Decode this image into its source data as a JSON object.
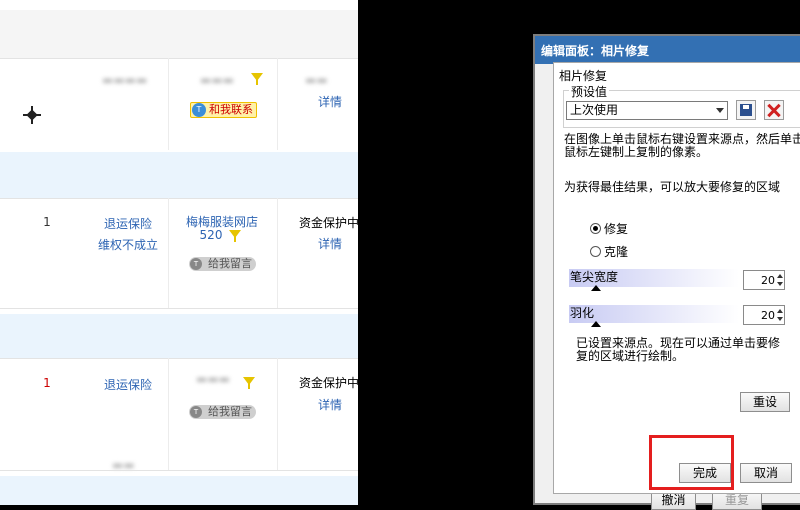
{
  "left_page": {
    "row_top": {
      "contact_badge": "和我联系",
      "detail_link": "详情"
    },
    "rows": [
      {
        "quantity": "1",
        "insurance_link": "退运保险",
        "dispute_status": "维权不成立",
        "store_name": "梅梅服装网店",
        "store_number": "520",
        "message_badge": "给我留言",
        "protection_text": "资金保护中",
        "detail_link": "详情"
      },
      {
        "quantity": "1",
        "insurance_link": "退运保险",
        "message_badge": "给我留言",
        "protection_text": "资金保护中",
        "detail_link": "详情"
      }
    ]
  },
  "panel": {
    "title": "编辑面板：相片修复",
    "section_label": "相片修复",
    "preset_group_label": "预设值",
    "preset_selected": "上次使用",
    "instruction_1_line1": "在图像上单击鼠标右键设置来源点，然后单击",
    "instruction_1_line2": "鼠标左键制上复制的像素。",
    "instruction_2": "为获得最佳结果，可以放大要修复的区域",
    "mode_options": [
      {
        "label": "修复",
        "selected": true
      },
      {
        "label": "克隆",
        "selected": false
      }
    ],
    "sliders": [
      {
        "label": "笔尖宽度",
        "value": "20",
        "level": 0.16
      },
      {
        "label": "羽化",
        "value": "20",
        "level": 0.16
      }
    ],
    "status_line1": "已设置来源点。现在可以通过单击要修",
    "status_line2": "复的区域进行绘制。",
    "reset_button": "重设",
    "done_button": "完成",
    "cancel_button": "取消",
    "bg_cancel_button": "撤消",
    "bg_redo_button": "重复"
  },
  "colors": {
    "title_bar": "#3370b3",
    "highlight": "#e41e1e",
    "link": "#2d64b3"
  }
}
